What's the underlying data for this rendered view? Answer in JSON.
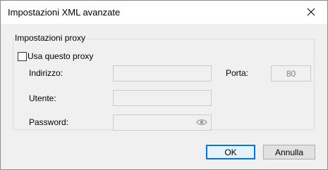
{
  "window": {
    "title": "Impostazioni XML avanzate"
  },
  "proxy_group": {
    "legend": "Impostazioni proxy",
    "use_proxy_label": "Usa questo proxy",
    "use_proxy_checked": false,
    "address_label": "Indirizzo:",
    "address_value": "",
    "port_label": "Porta:",
    "port_value": "80",
    "user_label": "Utente:",
    "user_value": "",
    "password_label": "Password:",
    "password_value": ""
  },
  "buttons": {
    "ok_label": "OK",
    "cancel_label": "Annulla"
  },
  "icons": {
    "close": "close-icon",
    "reveal_password": "eye-icon"
  },
  "colors": {
    "accent": "#0078d7",
    "dialog_background": "#f0f0f0",
    "disabled_text": "#7a7a7a"
  }
}
